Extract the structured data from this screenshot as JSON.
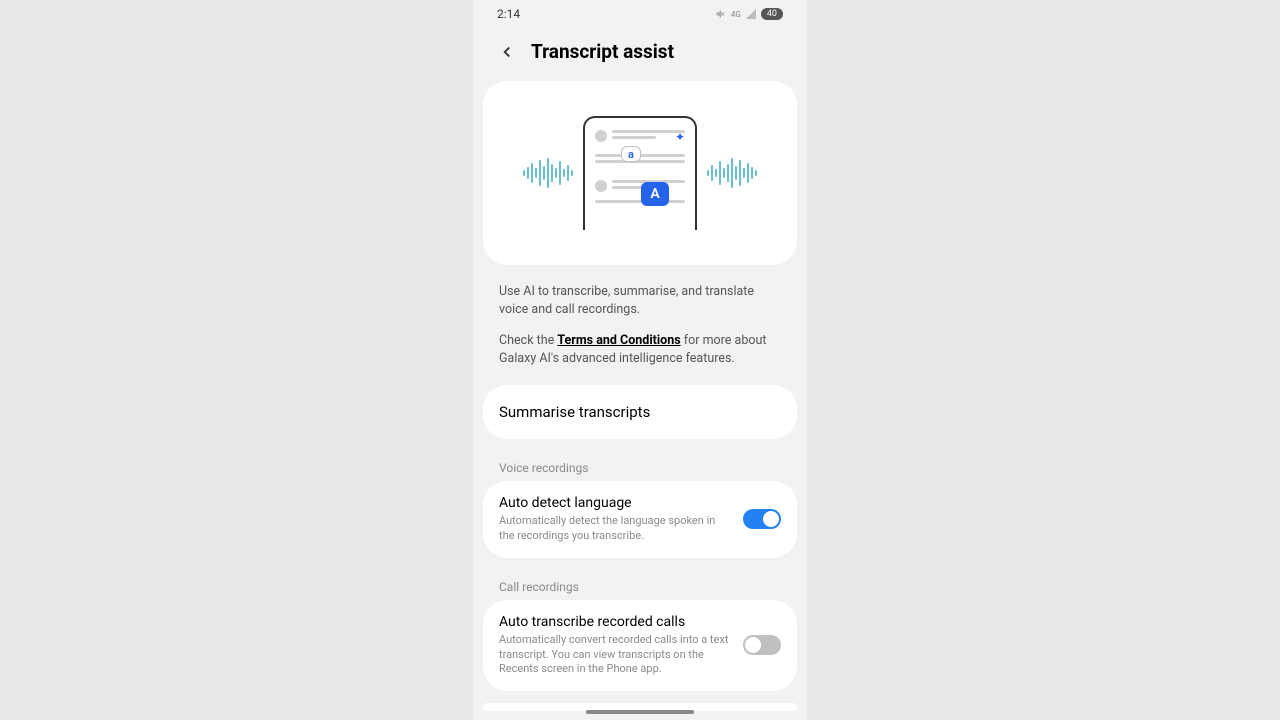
{
  "status": {
    "time": "2:14",
    "battery": "40"
  },
  "header": {
    "title": "Transcript assist"
  },
  "description": {
    "line1": "Use AI to transcribe, summarise, and translate voice and call recordings.",
    "line2_pre": "Check the ",
    "terms": "Terms and Conditions",
    "line2_post": " for more about Galaxy AI's advanced intelligence features."
  },
  "summarise": {
    "label": "Summarise transcripts"
  },
  "sections": {
    "voice": {
      "label": "Voice recordings",
      "item": {
        "title": "Auto detect language",
        "desc": "Automatically detect the language spoken in the recordings you transcribe.",
        "on": true
      }
    },
    "calls": {
      "label": "Call recordings",
      "item": {
        "title": "Auto transcribe recorded calls",
        "desc": "Automatically convert recorded calls into a text transcript. You can view transcripts on the Recents screen in the Phone app.",
        "on": false
      }
    }
  }
}
